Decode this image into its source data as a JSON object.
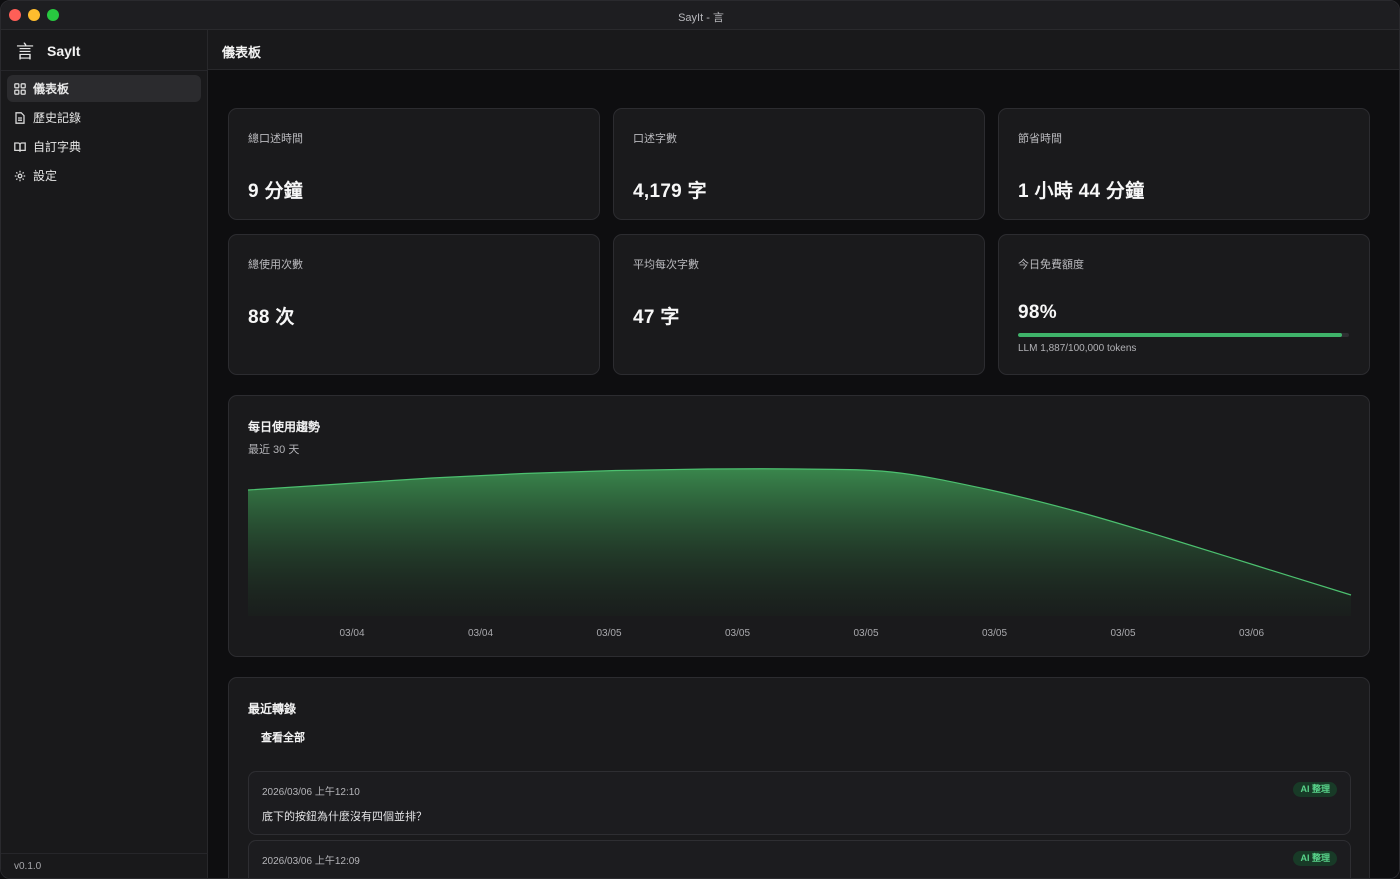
{
  "window": {
    "title": "SayIt - 言"
  },
  "sidebar": {
    "logo_glyph": "言",
    "app_name": "SayIt",
    "items": [
      {
        "label": "儀表板",
        "icon": "grid-icon",
        "active": true
      },
      {
        "label": "歷史記錄",
        "icon": "document-icon",
        "active": false
      },
      {
        "label": "自訂字典",
        "icon": "book-icon",
        "active": false
      },
      {
        "label": "設定",
        "icon": "gear-icon",
        "active": false
      }
    ],
    "version": "v0.1.0"
  },
  "header": {
    "title": "儀表板"
  },
  "stats": [
    {
      "label": "總口述時間",
      "value": "9 分鐘"
    },
    {
      "label": "口述字數",
      "value": "4,179 字"
    },
    {
      "label": "節省時間",
      "value": "1 小時 44 分鐘"
    },
    {
      "label": "總使用次數",
      "value": "88 次"
    },
    {
      "label": "平均每次字數",
      "value": "47 字"
    },
    {
      "label": "今日免費額度",
      "value": "98%",
      "detail": "LLM 1,887/100,000 tokens",
      "progress_percent": 98
    }
  ],
  "chart": {
    "title": "每日使用趨勢",
    "subtitle": "最近 30 天"
  },
  "chart_data": {
    "type": "area",
    "title": "每日使用趨勢",
    "x_tick_labels": [
      "03/04",
      "03/04",
      "03/05",
      "03/05",
      "03/05",
      "03/05",
      "03/05",
      "03/06"
    ],
    "y_relative": [
      0.84,
      0.88,
      0.92,
      0.95,
      0.97,
      0.98,
      0.98,
      0.96,
      0.85,
      0.7,
      0.52,
      0.33,
      0.14
    ],
    "ylim": [
      0,
      1
    ],
    "grid": false,
    "legend": "none",
    "color": "#4cc06f"
  },
  "recent": {
    "title": "最近轉錄",
    "view_all_label": "查看全部",
    "items": [
      {
        "time": "2026/03/06 上午12:10",
        "badge": "AI 整理",
        "text": "底下的按鈕為什麼沒有四個並排？"
      },
      {
        "time": "2026/03/06 上午12:09",
        "badge": "AI 整理",
        "text": ""
      }
    ]
  },
  "colors": {
    "accent": "#3fb36a",
    "badge_bg": "#183a27",
    "badge_text": "#58d38a"
  }
}
